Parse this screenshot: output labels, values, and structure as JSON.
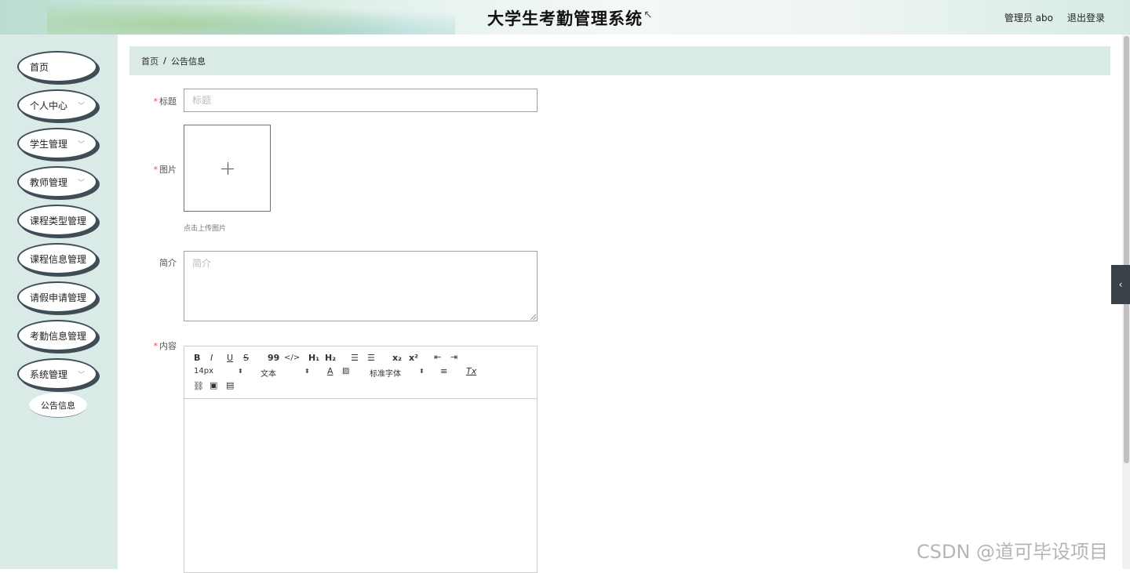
{
  "header": {
    "title": "大学生考勤管理系统",
    "user": "管理员 abo",
    "logout": "退出登录"
  },
  "sidebar": {
    "items": [
      {
        "label": "首页"
      },
      {
        "label": "个人中心"
      },
      {
        "label": "学生管理"
      },
      {
        "label": "教师管理"
      },
      {
        "label": "课程类型管理"
      },
      {
        "label": "课程信息管理"
      },
      {
        "label": "请假申请管理"
      },
      {
        "label": "考勤信息管理"
      },
      {
        "label": "系统管理"
      }
    ],
    "submenu": {
      "label": "公告信息"
    }
  },
  "breadcrumb": {
    "home": "首页",
    "separator": "/",
    "current": "公告信息"
  },
  "form": {
    "title": {
      "label": "标题",
      "placeholder": "标题",
      "required_mark": "*"
    },
    "image": {
      "label": "图片",
      "hint": "点击上传图片",
      "required_mark": "*"
    },
    "intro": {
      "label": "简介",
      "placeholder": "简介"
    },
    "content": {
      "label": "内容",
      "required_mark": "*",
      "toolbar": {
        "bold": "B",
        "italic": "I",
        "underline": "U",
        "strike": "S",
        "quote": "99",
        "code": "</>",
        "h1": "H₁",
        "h2": "H₂",
        "ordered_list": "☰",
        "bullet_list": "☰",
        "sub": "x₂",
        "sup": "x²",
        "indent_out": "⇤",
        "indent_in": "⇥",
        "size_value": "14px",
        "size_arrow": "⬍",
        "block_value": "文本",
        "block_arrow": "⬍",
        "font_color": "A",
        "bg_color": "▨",
        "font_value": "标准字体",
        "font_arrow": "⬍",
        "align": "≡",
        "clear": "Tx",
        "link": "⛓",
        "image": "▣",
        "video": "▤"
      }
    }
  },
  "side_tab": "‹",
  "watermark": "CSDN @道可毕设项目",
  "cursor": "↖"
}
